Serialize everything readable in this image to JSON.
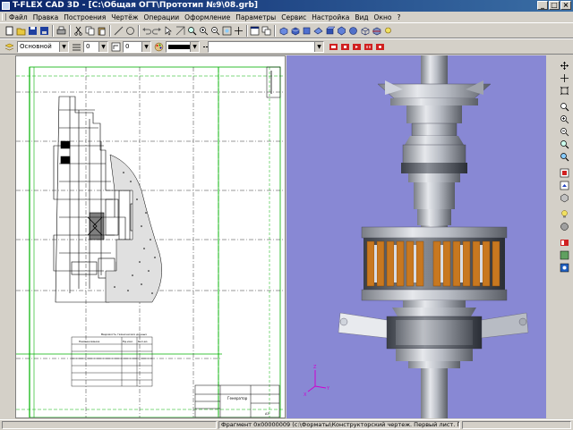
{
  "window": {
    "title": "T-FLEX CAD 3D - [C:\\Общая ОГТ\\Прототип №9\\08.grb]",
    "minimize_glyph": "_",
    "restore_glyph": "□",
    "close_glyph": "×"
  },
  "menu": {
    "items": [
      "Файл",
      "Правка",
      "Построения",
      "Чертёж",
      "Операции",
      "Оформление",
      "Параметры",
      "Сервис",
      "Настройка",
      "Вид",
      "Окно",
      "?"
    ]
  },
  "toolbar2": {
    "layer_value": "Основной",
    "width_value": "0",
    "level_value": "0",
    "pattern_value": ""
  },
  "drawing": {
    "sheet_format": "А3",
    "title_block_text": "Генератор",
    "table_title": "Ведомость технических данных",
    "table_headers": [
      "Наименование",
      "Ед.изм.",
      "Кол-во"
    ]
  },
  "status": {
    "panel1": "",
    "panel2": "Фрагмент 0x00000009 (c:\\Форматы\\Конструкторский чертеж. Первый лист. ГОСТ 2.104-68)",
    "panel3": ""
  },
  "colors": {
    "title_start": "#0a246a",
    "title_end": "#3a6ea5",
    "viewport_bg": "#8888d4",
    "drawing_frame": "#00b000",
    "drawing_lines": "#000000",
    "coil_orange": "#c87820",
    "model_gray": "#b8bcc4"
  },
  "icons": {
    "app": "tflex-app-icon",
    "axes": "coordinate-axes-icon"
  }
}
